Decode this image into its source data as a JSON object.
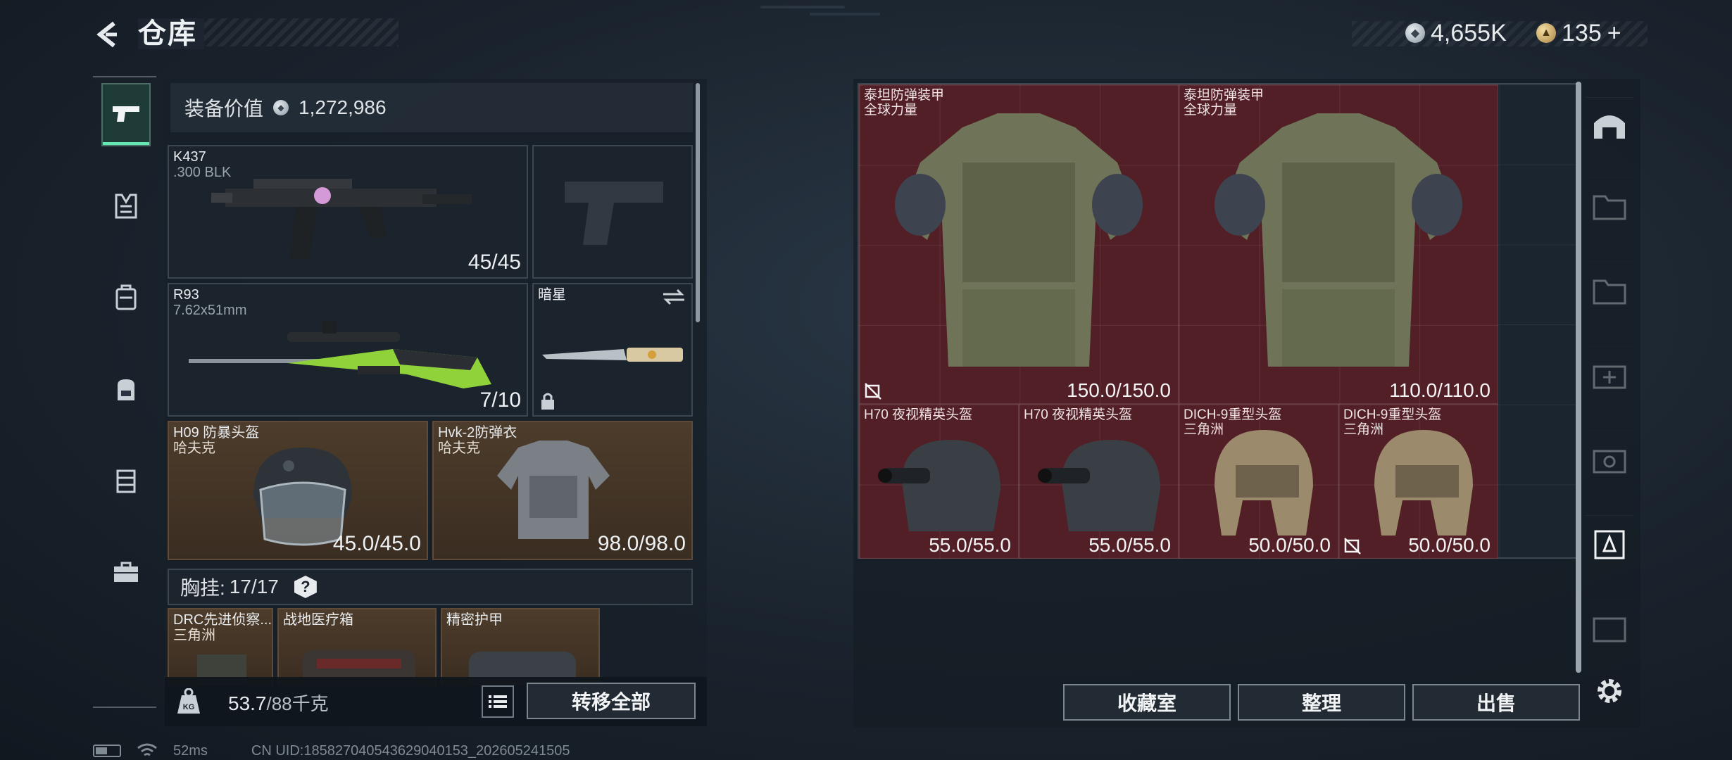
{
  "header": {
    "title": "仓库",
    "currency_silver": "4,655K",
    "currency_gold": "135",
    "currency_add": "+"
  },
  "left_tabs": [
    {
      "icon": "pistol-icon",
      "active": true
    },
    {
      "icon": "vest-icon"
    },
    {
      "icon": "backpack-vest-icon"
    },
    {
      "icon": "backpack-icon"
    },
    {
      "icon": "case-icon"
    },
    {
      "icon": "briefcase-icon"
    }
  ],
  "loadout": {
    "value_label": "装备价值",
    "value": "1,272,986",
    "primary": {
      "name": "K437",
      "ammo": ".300 BLK",
      "durability": "45/45"
    },
    "sidearm": {
      "name": ""
    },
    "secondary": {
      "name": "R93",
      "ammo": "7.62x51mm",
      "durability": "7/10"
    },
    "melee": {
      "name": "暗星"
    },
    "helmet": {
      "name": "H09 防暴头盔",
      "maker": "哈夫克",
      "durability": "45.0/45.0"
    },
    "armor": {
      "name": "Hvk-2防弹衣",
      "maker": "哈夫克",
      "durability": "98.0/98.0"
    },
    "chest_rig": {
      "label": "胸挂:",
      "count": "17/17"
    },
    "chest_items": [
      {
        "name": "DRC先进侦察...",
        "maker": "三角洲"
      },
      {
        "name": "战地医疗箱",
        "maker": ""
      },
      {
        "name": "精密护甲",
        "maker": ""
      }
    ]
  },
  "bottom": {
    "weight": "53.7",
    "weight_max": "/88千克",
    "transfer_all": "转移全部"
  },
  "stash": {
    "items": [
      {
        "name": "泰坦防弹装甲",
        "maker": "全球力量",
        "durability": "150.0/150.0",
        "flag": true
      },
      {
        "name": "泰坦防弹装甲",
        "maker": "全球力量",
        "durability": "110.0/110.0",
        "flag": false
      },
      {
        "name": "H70 夜视精英头盔",
        "maker": "",
        "durability": "55.0/55.0",
        "flag": false
      },
      {
        "name": "H70 夜视精英头盔",
        "maker": "",
        "durability": "55.0/55.0",
        "flag": false
      },
      {
        "name": "DICH-9重型头盔",
        "maker": "三角洲",
        "durability": "50.0/50.0",
        "flag": false
      },
      {
        "name": "DICH-9重型头盔",
        "maker": "三角洲",
        "durability": "50.0/50.0",
        "flag": true
      }
    ],
    "buttons": {
      "collection": "收藏室",
      "organize": "整理",
      "sell": "出售"
    }
  },
  "footer": {
    "ping": "52ms",
    "uid": "CN UID:185827040543629040153_202605241505"
  }
}
